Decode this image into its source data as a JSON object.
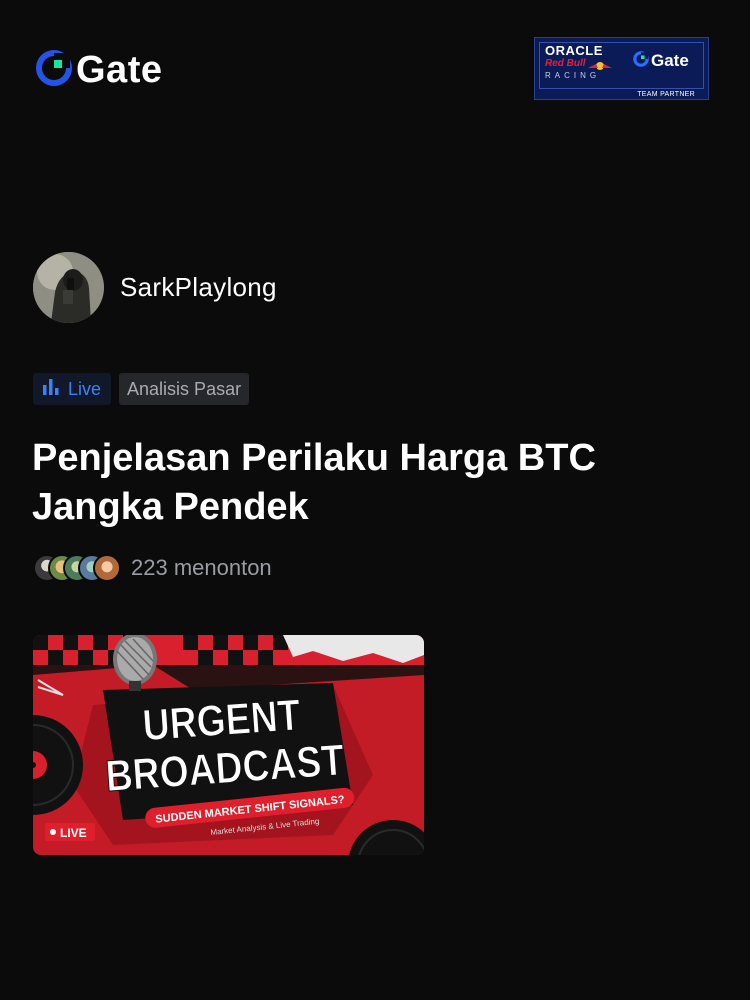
{
  "header": {
    "logo_text": "Gate",
    "partner": {
      "oracle": "ORACLE",
      "redbull": "Red Bull",
      "racing": "RACING",
      "gate": "Gate",
      "team_partner": "TEAM PARTNER"
    }
  },
  "host": {
    "name": "SarkPlaylong"
  },
  "tags": {
    "live_label": "Live",
    "category": "Analisis Pasar"
  },
  "stream": {
    "title": "Penjelasan Perilaku Harga BTC Jangka Pendek",
    "viewers_text": "223 menonton"
  },
  "thumbnail": {
    "headline_1": "URGENT",
    "headline_2": "BROADCAST",
    "ribbon": "SUDDEN MARKET SHIFT SIGNALS?",
    "sub": "Market Analysis & Live Trading",
    "live_badge": "LIVE"
  },
  "colors": {
    "background": "#0b0b0c",
    "accent_blue": "#3b82f6",
    "brand_green": "#17e5a1",
    "thumb_red": "#d9202e"
  }
}
